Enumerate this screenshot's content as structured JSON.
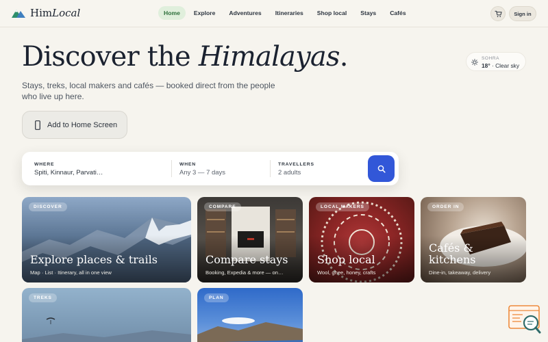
{
  "brand": {
    "name_plain": "Him",
    "name_italic": "Local"
  },
  "nav": {
    "links": [
      "Home",
      "Explore",
      "Adventures",
      "Itineraries",
      "Shop local",
      "Stays",
      "Cafés"
    ],
    "active": "Home",
    "signin_label": "Sign in",
    "cart_icon": "cart-icon"
  },
  "hero": {
    "title_plain": "Discover the ",
    "title_italic": "Himalayas",
    "title_end": ".",
    "subtitle": "Stays, treks, local makers and cafés — booked direct from the people who live up here.",
    "install_label": "Add to Home Screen"
  },
  "weather": {
    "place": "SOHRA",
    "temp": "18°",
    "condition": " · Clear sky",
    "icon": "sun-icon"
  },
  "search": {
    "where_label": "WHERE",
    "where_value": "Spiti, Kinnaur, Parvati…",
    "when_label": "WHEN",
    "when_value": "Any 3 — 7 days",
    "travellers_label": "TRAVELLERS",
    "travellers_value": "2 adults",
    "button_icon": "search-icon"
  },
  "cards": [
    {
      "chip": "DISCOVER",
      "title": "Explore places & trails",
      "desc": "Map · List · Itinerary, all in one view"
    },
    {
      "chip": "COMPARE",
      "title": "Compare stays",
      "desc": "Booking, Expedia & more — on…"
    },
    {
      "chip": "LOCAL MAKERS",
      "title": "Shop local",
      "desc": "Wool, ghee, honey, crafts"
    },
    {
      "chip": "ORDER IN",
      "title": "Cafés & kitchens",
      "desc": "Dine-in, takeaway, delivery"
    },
    {
      "chip": "TREKS"
    },
    {
      "chip": "PLAN"
    }
  ],
  "colors": {
    "accent": "#3257d8",
    "active_nav_bg": "#e0efdc",
    "active_nav_text": "#2c6e3a",
    "background": "#f6f4ee"
  }
}
